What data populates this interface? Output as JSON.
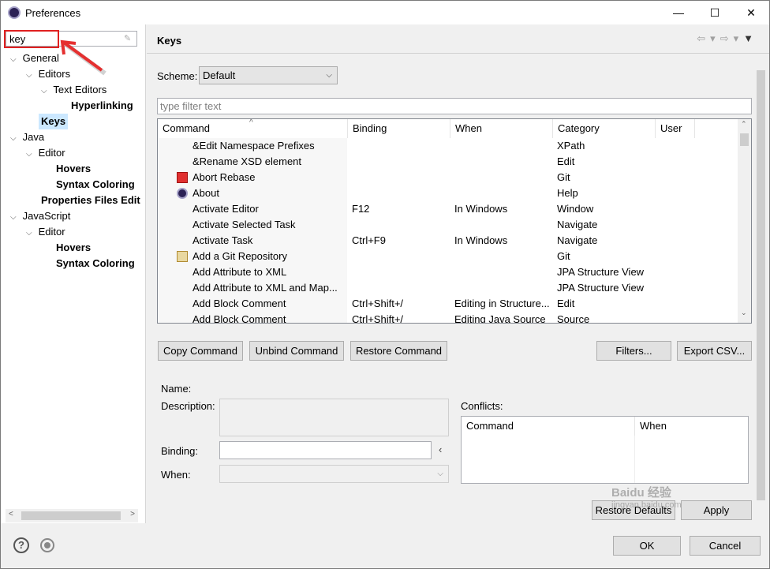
{
  "window": {
    "title": "Preferences",
    "minimize": "—",
    "maximize": "☐",
    "close": "✕"
  },
  "sidebar": {
    "filter_value": "key",
    "tree": [
      {
        "label": "General",
        "level": 0,
        "twisty": "expanded",
        "bold": false
      },
      {
        "label": "Editors",
        "level": 1,
        "twisty": "expanded",
        "bold": false
      },
      {
        "label": "Text Editors",
        "level": 2,
        "twisty": "expanded",
        "bold": false
      },
      {
        "label": "Hyperlinking",
        "level": 3,
        "twisty": "none",
        "bold": true
      },
      {
        "label": "Keys",
        "level": 1,
        "twisty": "none",
        "bold": true,
        "selected": true
      },
      {
        "label": "Java",
        "level": 0,
        "twisty": "expanded",
        "bold": false
      },
      {
        "label": "Editor",
        "level": 1,
        "twisty": "expanded",
        "bold": false
      },
      {
        "label": "Hovers",
        "level": 2,
        "twisty": "none",
        "bold": true
      },
      {
        "label": "Syntax Coloring",
        "level": 2,
        "twisty": "none",
        "bold": true
      },
      {
        "label": "Properties Files Edit",
        "level": 1,
        "twisty": "none",
        "bold": true
      },
      {
        "label": "JavaScript",
        "level": 0,
        "twisty": "expanded",
        "bold": false
      },
      {
        "label": "Editor",
        "level": 1,
        "twisty": "expanded",
        "bold": false
      },
      {
        "label": "Hovers",
        "level": 2,
        "twisty": "none",
        "bold": true
      },
      {
        "label": "Syntax Coloring",
        "level": 2,
        "twisty": "none",
        "bold": true
      }
    ]
  },
  "main": {
    "title": "Keys",
    "scheme_label": "Scheme:",
    "scheme_value": "Default",
    "filter_placeholder": "type filter text",
    "columns": [
      "Command",
      "Binding",
      "When",
      "Category",
      "User"
    ],
    "rows": [
      {
        "command": "&Edit Namespace Prefixes",
        "binding": "",
        "when": "",
        "category": "XPath",
        "icon": ""
      },
      {
        "command": "&Rename XSD element",
        "binding": "",
        "when": "",
        "category": "Edit",
        "icon": ""
      },
      {
        "command": "Abort Rebase",
        "binding": "",
        "when": "",
        "category": "Git",
        "icon": "stop-icon"
      },
      {
        "command": "About",
        "binding": "",
        "when": "",
        "category": "Help",
        "icon": "eclipse-icon"
      },
      {
        "command": "Activate Editor",
        "binding": "F12",
        "when": "In Windows",
        "category": "Window",
        "icon": ""
      },
      {
        "command": "Activate Selected Task",
        "binding": "",
        "when": "",
        "category": "Navigate",
        "icon": ""
      },
      {
        "command": "Activate Task",
        "binding": "Ctrl+F9",
        "when": "In Windows",
        "category": "Navigate",
        "icon": ""
      },
      {
        "command": "Add a Git Repository",
        "binding": "",
        "when": "",
        "category": "Git",
        "icon": "git-add-icon"
      },
      {
        "command": "Add Attribute to XML",
        "binding": "",
        "when": "",
        "category": "JPA Structure View",
        "icon": ""
      },
      {
        "command": "Add Attribute to XML and Map...",
        "binding": "",
        "when": "",
        "category": "JPA Structure View",
        "icon": ""
      },
      {
        "command": "Add Block Comment",
        "binding": "Ctrl+Shift+/",
        "when": "Editing in Structure...",
        "category": "Edit",
        "icon": ""
      },
      {
        "command": "Add Block Comment",
        "binding": "Ctrl+Shift+/",
        "when": "Editing Java Source",
        "category": "Source",
        "icon": ""
      }
    ],
    "buttons": {
      "copy": "Copy Command",
      "unbind": "Unbind Command",
      "restore": "Restore Command",
      "filters": "Filters...",
      "export": "Export CSV..."
    },
    "details": {
      "name_label": "Name:",
      "description_label": "Description:",
      "binding_label": "Binding:",
      "when_label": "When:",
      "conflicts_label": "Conflicts:",
      "conflict_columns": [
        "Command",
        "When"
      ]
    },
    "restore_defaults": "Restore Defaults",
    "apply": "Apply"
  },
  "footer": {
    "ok": "OK",
    "cancel": "Cancel"
  },
  "overlay": {
    "watermark": "Baidu 经验",
    "watermark_url": "jingyan.baidu.com",
    "annotation_color": "#e02020"
  }
}
